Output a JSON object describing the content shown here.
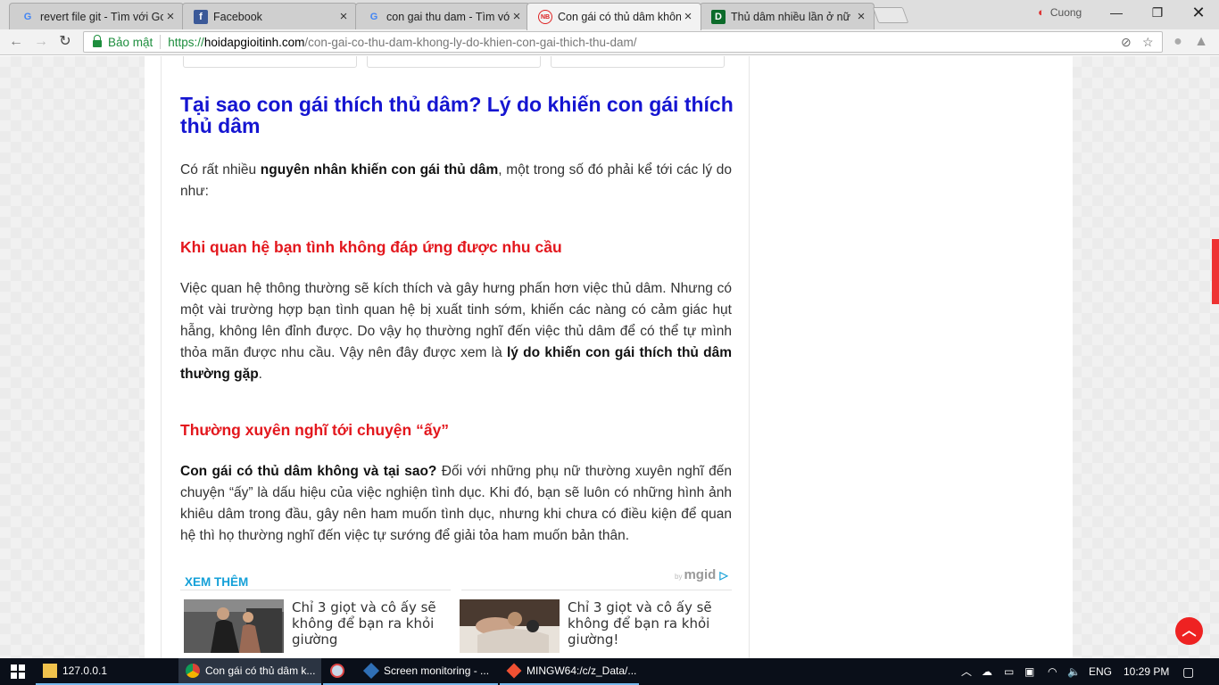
{
  "browser": {
    "tabs": [
      {
        "title": "revert file git - Tìm với Gc",
        "icon": "google-icon"
      },
      {
        "title": "Facebook",
        "icon": "facebook-icon"
      },
      {
        "title": "con gai thu dam - Tìm với",
        "icon": "google-icon"
      },
      {
        "title": "Con gái có thủ dâm khôn",
        "icon": "hoidap-icon"
      },
      {
        "title": "Thủ dâm nhiều lần ở nữ g",
        "icon": "d-site-icon"
      }
    ],
    "profile_name": "Cuong",
    "security_label": "Bảo mật",
    "url_scheme": "https://",
    "url_host": "hoidapgioitinh.com",
    "url_path": "/con-gai-co-thu-dam-khong-ly-do-khien-con-gai-thich-thu-dam/"
  },
  "article": {
    "heading": "Tại sao con gái thích thủ dâm? Lý do khiến con gái thích thủ dâm",
    "intro_pre": "Có rất nhiều ",
    "intro_bold": "nguyên nhân khiến con gái thủ dâm",
    "intro_post": ", một trong số đó phải kể tới các lý do như:",
    "section1_title": "Khi quan hệ bạn tình không đáp ứng được nhu cầu",
    "section1_text": "Việc quan hệ thông thường sẽ kích thích và gây hưng phấn hơn việc thủ dâm. Nhưng có một vài trường hợp bạn tình quan hệ bị xuất tinh sớm, khiến các nàng có cảm giác hụt hẫng, không lên đỉnh được. Do vậy họ thường nghĩ đến việc thủ dâm để có thể tự mình thỏa mãn được nhu cầu. Vậy nên đây được xem là ",
    "section1_bold": "lý do khiến con gái thích thủ dâm thường gặp",
    "section1_end": ".",
    "section2_title": "Thường xuyên nghĩ tới chuyện “ấy”",
    "section2_bold": "Con gái có thủ dâm không và tại sao?",
    "section2_text": " Đối với những phụ nữ thường xuyên nghĩ đến chuyện “ấy” là dấu hiệu của việc nghiện tình dục. Khi đó, bạn sẽ luôn có những hình ảnh khiêu dâm trong đầu, gây nên ham muốn tình dục, nhưng khi chưa có điều kiện để quan hệ thì họ thường nghĩ đến việc tự sướng để giải tỏa ham muốn bản thân."
  },
  "related": {
    "heading": "XEM THÊM",
    "brand_by": "by",
    "brand": "mgid",
    "cards": [
      {
        "title": "Chỉ 3 giọt và cô ấy sẽ không để bạn ra khỏi giường"
      },
      {
        "title": "Chỉ 3 giọt và cô ấy sẽ không để bạn ra khỏi giường!"
      }
    ]
  },
  "taskbar": {
    "items": [
      {
        "label": "127.0.0.1",
        "icon": "folder-icon"
      },
      {
        "label": "Con gái có thủ dâm k...",
        "icon": "chrome-icon"
      },
      {
        "label": "",
        "icon": "paint-icon"
      },
      {
        "label": "Screen monitoring - ...",
        "icon": "virtualbox-icon"
      },
      {
        "label": "MINGW64:/c/z_Data/...",
        "icon": "git-icon"
      }
    ],
    "language": "ENG",
    "time": "10:29 PM"
  },
  "colors": {
    "heading_blue": "#1515d1",
    "section_red": "#e3171d",
    "related_blue": "#14a0d8",
    "secure_green": "#1e8e3e"
  }
}
